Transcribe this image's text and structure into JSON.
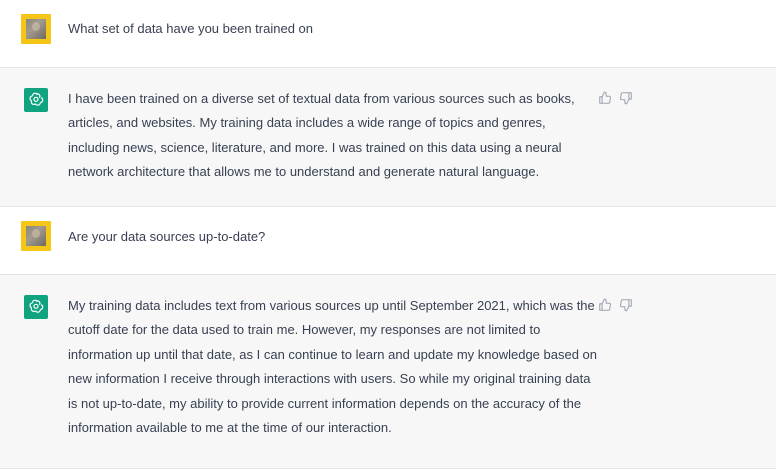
{
  "conversation": [
    {
      "role": "user",
      "avatar_icon": "user-photo-avatar",
      "text": "What set of data have you been trained on"
    },
    {
      "role": "assistant",
      "avatar_icon": "openai-logo-icon",
      "text": "I have been trained on a diverse set of textual data from various sources such as books, articles, and websites. My training data includes a wide range of topics and genres, including news, science, literature, and more. I was trained on this data using a neural network architecture that allows me to understand and generate natural language.",
      "feedback": [
        "thumbs-up-icon",
        "thumbs-down-icon"
      ]
    },
    {
      "role": "user",
      "avatar_icon": "user-photo-avatar",
      "text": "Are your data sources up-to-date?"
    },
    {
      "role": "assistant",
      "avatar_icon": "openai-logo-icon",
      "text": "My training data includes text from various sources up until September 2021, which was the cutoff date for the data used to train me. However, my responses are not limited to information up until that date, as I can continue to learn and update my knowledge based on new information I receive through interactions with users. So while my original training data is not up-to-date, my ability to provide current information depends on the accuracy of the information available to me at the time of our interaction.",
      "feedback": [
        "thumbs-up-icon",
        "thumbs-down-icon"
      ]
    }
  ],
  "colors": {
    "user_bg": "#ffffff",
    "assistant_bg": "#f7f7f8",
    "user_avatar_border": "#f5c518",
    "assistant_avatar": "#10a37f",
    "text": "#374151"
  }
}
